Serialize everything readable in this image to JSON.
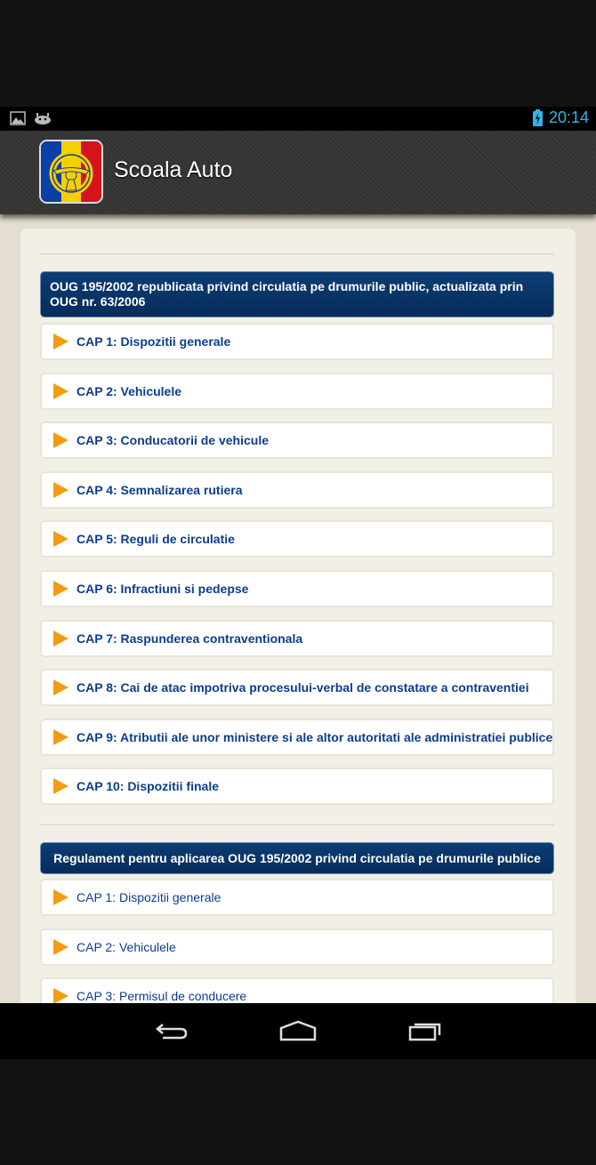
{
  "status_bar": {
    "time": "20:14"
  },
  "action_bar": {
    "title": "Scoala Auto"
  },
  "sections": [
    {
      "title": "OUG 195/2002 republicata privind circulatia pe drumurile public, actualizata prin OUG nr. 63/2006",
      "items": [
        "CAP 1: Dispozitii generale",
        "CAP 2: Vehiculele",
        "CAP 3: Conducatorii de vehicule",
        "CAP 4: Semnalizarea rutiera",
        "CAP 5: Reguli de circulatie",
        "CAP 6: Infractiuni si pedepse",
        "CAP 7: Raspunderea contraventionala",
        "CAP 8: Cai de atac impotriva procesului-verbal de constatare a contraventiei",
        "CAP 9: Atributii ale unor ministere si ale altor autoritati ale administratiei publice",
        "CAP 10: Dispozitii finale"
      ]
    },
    {
      "title": "Regulament pentru aplicarea OUG 195/2002 privind circulatia pe drumurile publice",
      "items": [
        "CAP 1: Dispozitii generale",
        "CAP 2: Vehiculele",
        "CAP 3: Permisul de conducere"
      ]
    }
  ],
  "colors": {
    "header_bg": "#062c59",
    "item_text": "#0e3c8c",
    "arrow": "#f39c12",
    "status": "#33b5e5"
  }
}
